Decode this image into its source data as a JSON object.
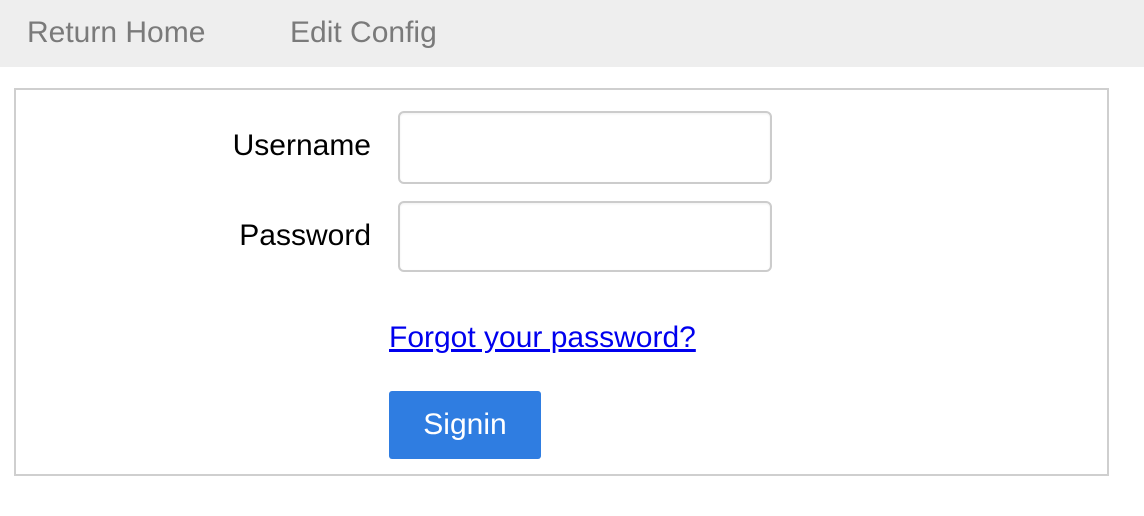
{
  "nav": {
    "return_home": "Return Home",
    "edit_config": "Edit Config"
  },
  "form": {
    "username_label": "Username",
    "username_value": "",
    "password_label": "Password",
    "password_value": "",
    "forgot_link": "Forgot your password?",
    "signin_label": "Signin"
  },
  "colors": {
    "topbar_bg": "#eeeeee",
    "nav_text": "#7a7a7a",
    "link": "#0000ee",
    "button_bg": "#2f7de1",
    "button_text": "#ffffff",
    "box_border": "#cfcfcf"
  }
}
